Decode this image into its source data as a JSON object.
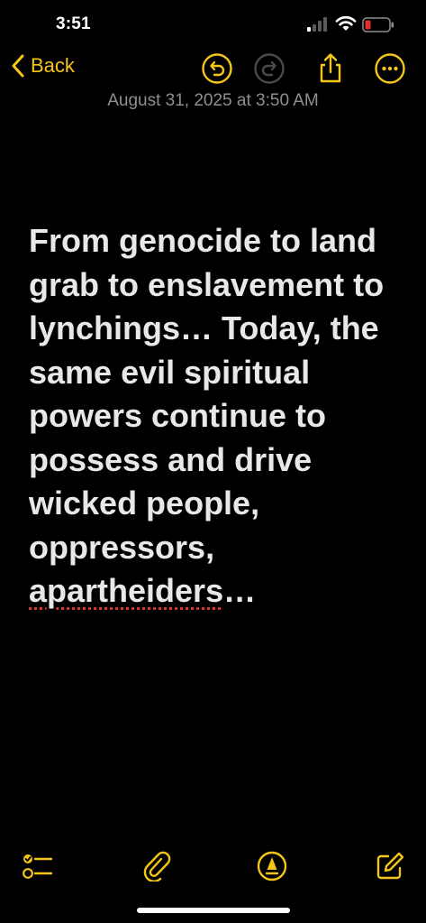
{
  "status": {
    "time": "3:51",
    "battery_color": "#e0312f"
  },
  "nav": {
    "back_label": "Back",
    "accent": "#f5c518",
    "icons": [
      "undo-icon",
      "redo-icon",
      "share-icon",
      "more-icon"
    ]
  },
  "note": {
    "date": "August 31, 2025 at 3:50 AM",
    "text_before": "From genocide to land grab to enslavement to lynchings… Today, the same evil spiritual powers continue to possess and drive wicked people, oppressors, ",
    "misspelled_word": "apartheiders",
    "text_after": "…"
  },
  "toolbar": {
    "icons": [
      "checklist-icon",
      "paperclip-icon",
      "markup-pen-icon",
      "compose-icon"
    ]
  }
}
